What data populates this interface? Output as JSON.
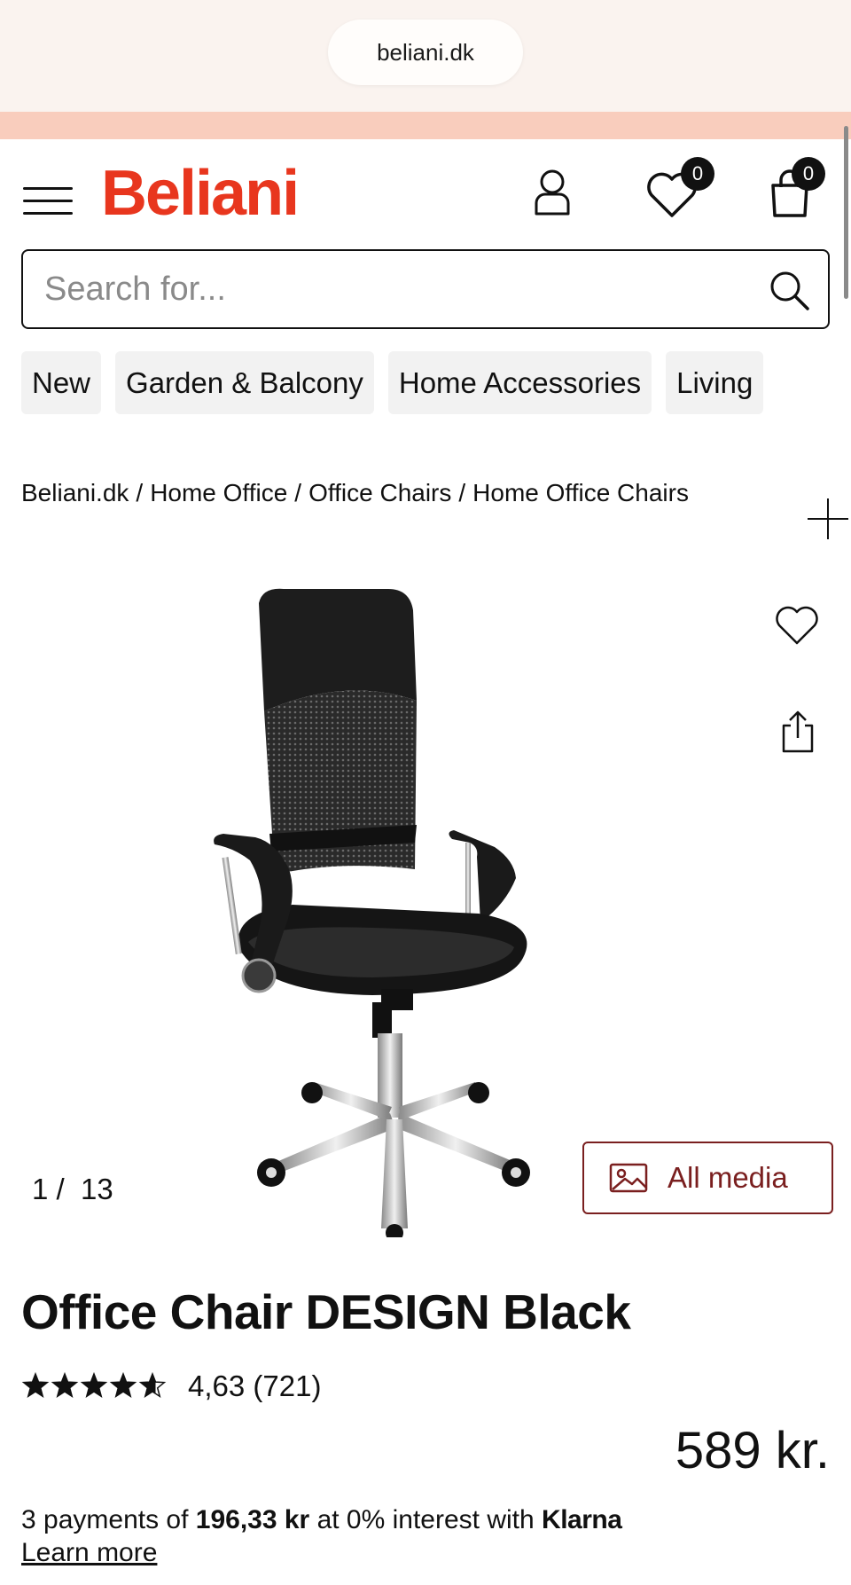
{
  "browser": {
    "url": "beliani.dk"
  },
  "header": {
    "logo": "Beliani",
    "wishlist_count": "0",
    "cart_count": "0"
  },
  "search": {
    "placeholder": "Search for..."
  },
  "categories": [
    "New",
    "Garden & Balcony",
    "Home Accessories",
    "Living"
  ],
  "breadcrumb": [
    "Beliani.dk",
    "Home Office",
    "Office Chairs",
    "Home Office Chairs"
  ],
  "gallery": {
    "current": "1",
    "total": "13",
    "all_media_label": "All media"
  },
  "product": {
    "title": "Office Chair DESIGN Black",
    "rating_value": "4,63",
    "rating_count": "(721)",
    "rating_stars": 4.63,
    "price": "589 kr."
  },
  "klarna": {
    "prefix": "3 payments of ",
    "amount": "196,33 kr",
    "middle": " at 0% interest with ",
    "brand": "Klarna",
    "learn_more": "Learn more"
  },
  "colors": {
    "brand": "#e8361e",
    "accent_strip": "#f9cdbd",
    "media_button": "#7a1f1f"
  }
}
